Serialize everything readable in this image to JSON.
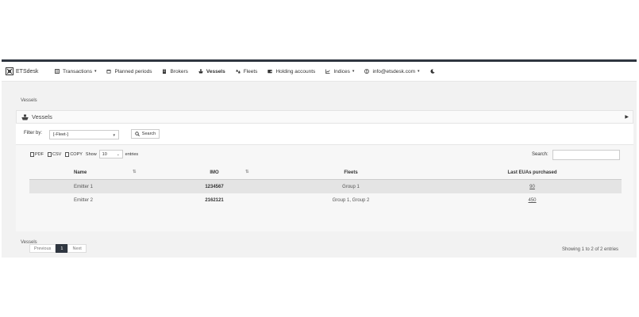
{
  "brand": {
    "name": "ETSdesk"
  },
  "nav": {
    "items": [
      {
        "label": "Transactions",
        "icon": "exchange-icon",
        "dropdown": true
      },
      {
        "label": "Planned periods",
        "icon": "calendar-icon",
        "dropdown": false
      },
      {
        "label": "Brokers",
        "icon": "building-icon",
        "dropdown": false
      },
      {
        "label": "Vessels",
        "icon": "ship-icon",
        "dropdown": false,
        "active": true
      },
      {
        "label": "Fleets",
        "icon": "ships-icon",
        "dropdown": false
      },
      {
        "label": "Holding accounts",
        "icon": "wallet-icon",
        "dropdown": false
      },
      {
        "label": "Indices",
        "icon": "chart-line-icon",
        "dropdown": true
      },
      {
        "label": "info@etsdesk.com",
        "icon": "user-icon",
        "dropdown": true
      }
    ],
    "theme_icon": "moon-icon"
  },
  "breadcrumb_top": "Vessels",
  "breadcrumb_bottom": "Vessels",
  "panel": {
    "title": "Vessels"
  },
  "filter": {
    "label": "Filter by:",
    "select_value": "[-Fleet-]",
    "search_button": "Search"
  },
  "exports": {
    "pdf": "PDF",
    "csv": "CSV",
    "copy": "COPY"
  },
  "length": {
    "show": "Show",
    "value": "10",
    "entries": "entries"
  },
  "search": {
    "label": "Search:",
    "value": ""
  },
  "table": {
    "headers": {
      "name": "Name",
      "imo": "IMO",
      "fleets": "Fleets",
      "euas": "Last EUAs purchased"
    },
    "rows": [
      {
        "name": "Emitter 1",
        "imo": "1234567",
        "fleets": "Group 1",
        "euas": "90"
      },
      {
        "name": "Emitter 2",
        "imo": "2162121",
        "fleets": "Group 1, Group 2",
        "euas": "450"
      }
    ]
  },
  "pagination": {
    "previous": "Previous",
    "current": "1",
    "next": "Next"
  },
  "info": "Showing 1 to 2 of 2 entries",
  "colors": {
    "dark": "#2f3640",
    "background": "#f2f2f2"
  }
}
